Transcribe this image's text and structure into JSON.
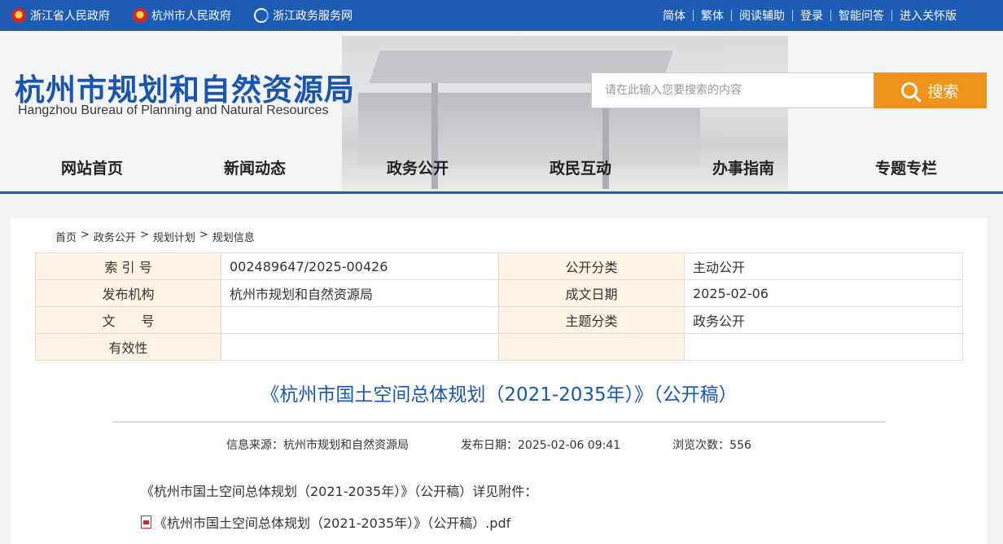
{
  "topbar": {
    "links": [
      "浙江省人民政府",
      "杭州市人民政府",
      "浙江政务服务网"
    ],
    "right_items": [
      "简体",
      "繁体",
      "阅读辅助",
      "登录",
      "智能问答",
      "进入关怀版"
    ]
  },
  "header": {
    "title_cn": "杭州市规划和自然资源局",
    "title_en": "Hangzhou Bureau of Planning and Natural Resources",
    "search_placeholder": "请在此输入您要搜索的内容",
    "search_button": "搜索"
  },
  "nav": [
    "网站首页",
    "新闻动态",
    "政务公开",
    "政民互动",
    "办事指南",
    "专题专栏"
  ],
  "breadcrumb": [
    "首页",
    ">",
    "政务公开",
    ">",
    "规划计划",
    ">",
    "规划信息"
  ],
  "meta": {
    "rows": [
      {
        "k1": "索 引 号",
        "v1": "002489647/2025-00426",
        "k2": "公开分类",
        "v2": "主动公开"
      },
      {
        "k1": "发布机构",
        "v1": "杭州市规划和自然资源局",
        "k2": "成文日期",
        "v2": "2025-02-06"
      },
      {
        "k1": "文　　号",
        "v1": "",
        "k2": "主题分类",
        "v2": "政务公开"
      },
      {
        "k1": "有效性",
        "v1": "",
        "k2": "",
        "v2": ""
      }
    ]
  },
  "article": {
    "title": "《杭州市国土空间总体规划（2021-2035年）》（公开稿）",
    "source": "信息来源：杭州市规划和自然资源局",
    "date": "发布日期：2025-02-06 09:41",
    "views": "浏览次数：556",
    "body": "《杭州市国土空间总体规划（2021-2035年）》（公开稿）详见附件：",
    "attachment": "《杭州市国土空间总体规划（2021-2035年）》（公开稿）.pdf"
  },
  "colors": {
    "brand_blue": "#1d5bb5",
    "accent_orange": "#f0931a",
    "table_key_bg": "#fdf3e5"
  }
}
